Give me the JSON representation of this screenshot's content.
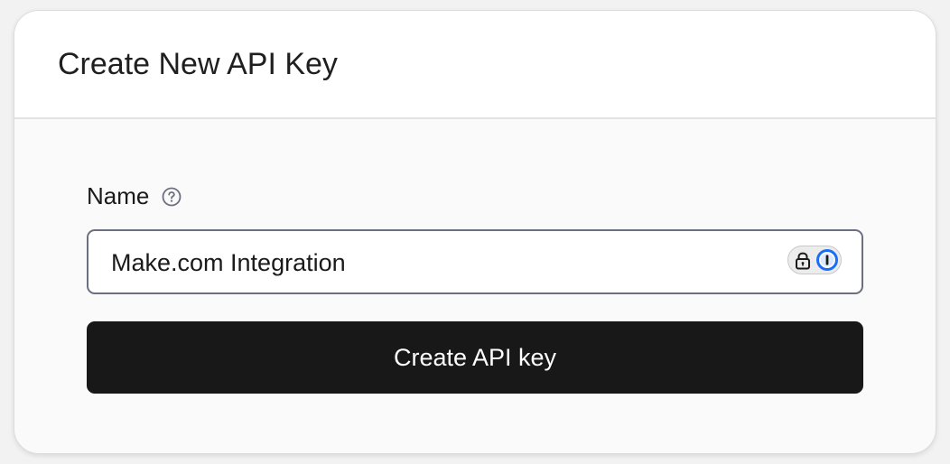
{
  "dialog": {
    "title": "Create New API Key"
  },
  "form": {
    "name_label": "Name",
    "help_icon": "question-circle-icon",
    "name_value": "Make.com Integration",
    "password_manager_icon": "1password-icon",
    "submit_label": "Create API key"
  },
  "colors": {
    "button_bg": "#181818",
    "input_border": "#6b6f80",
    "password_manager_accent": "#1a6ef5"
  }
}
